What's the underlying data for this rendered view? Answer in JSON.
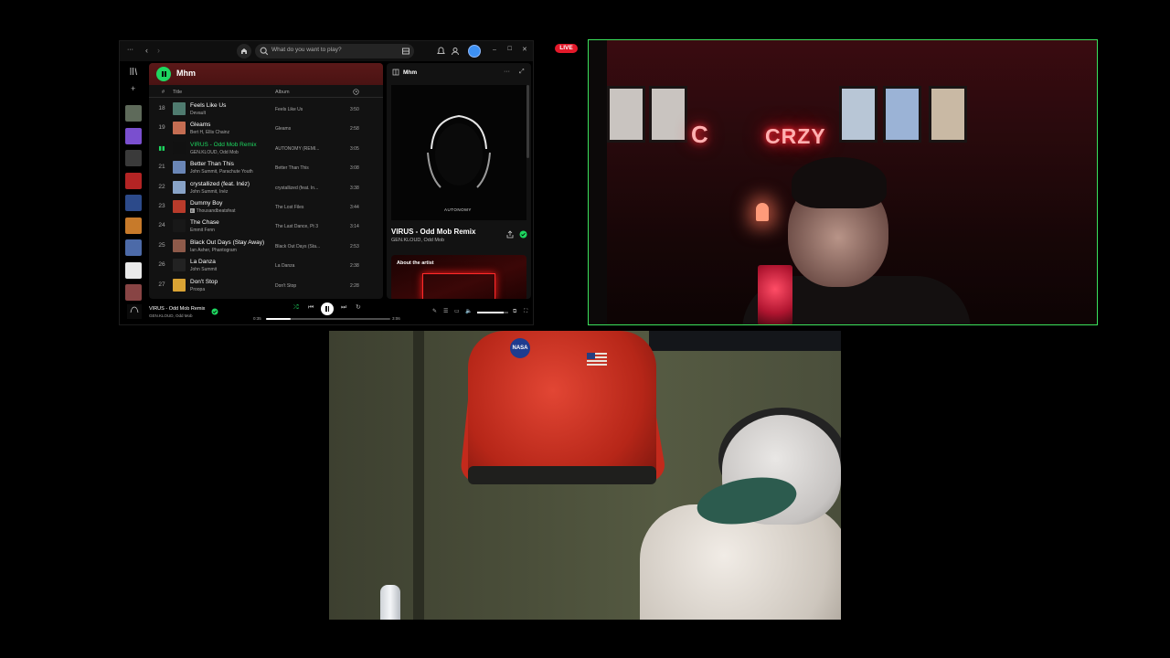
{
  "spotify": {
    "search_placeholder": "What do you want to play?",
    "playlist": {
      "title": "Mhm",
      "col_num": "#",
      "col_title": "Title",
      "col_album": "Album",
      "tracks": [
        {
          "num": "18",
          "title": "Feels Like Us",
          "artist": "Devault",
          "album": "Feels Like Us",
          "duration": "3:50",
          "color": "#4f7b6f"
        },
        {
          "num": "19",
          "title": "Gleams",
          "artist": "Bert H, Ellis Chainz",
          "album": "Gleams",
          "duration": "2:58",
          "color": "#c46d52"
        },
        {
          "num": "20",
          "title": "VIRUS - Odd Mob Remix",
          "artist": "GEN.KLOUD, Odd Mob",
          "album": "AUTONOMY (REMI...",
          "duration": "3:05",
          "color": "#111111",
          "active": true
        },
        {
          "num": "21",
          "title": "Better Than This",
          "artist": "John Summit, Parachute Youth",
          "album": "Better Than This",
          "duration": "3:08",
          "color": "#6a86b6"
        },
        {
          "num": "22",
          "title": "crystallized (feat. Inéz)",
          "artist": "John Summit, Inéz",
          "album": "crystallized (feat. In...",
          "duration": "3:38",
          "color": "#88a3c7"
        },
        {
          "num": "23",
          "title": "Dummy Boy",
          "artist": "Thousandbeatsfeat",
          "album": "The Lost Files",
          "duration": "3:44",
          "color": "#b83b2b",
          "explicit": "E"
        },
        {
          "num": "24",
          "title": "The Chase",
          "artist": "Emmit Fenn",
          "album": "The Last Dance, Pt 3",
          "duration": "3:14",
          "color": "#181818"
        },
        {
          "num": "25",
          "title": "Black Out Days (Stay Away)",
          "artist": "Ian Asher, Phantogram",
          "album": "Black Out Days (Sta...",
          "duration": "2:53",
          "color": "#8e5a4a"
        },
        {
          "num": "26",
          "title": "La Danza",
          "artist": "John Summit",
          "album": "La Danza",
          "duration": "2:38",
          "color": "#222222"
        },
        {
          "num": "27",
          "title": "Don't Stop",
          "artist": "Proopa",
          "album": "Don't Stop",
          "duration": "2:28",
          "color": "#d9a334"
        }
      ]
    },
    "now_playing": {
      "panel_title": "Mhm",
      "cover_text": "AUTONOMY",
      "title": "VIRUS - Odd Mob Remix",
      "artist": "GEN.KLOUD, Odd Mob",
      "about_label": "About the artist"
    },
    "player": {
      "title": "VIRUS - Odd Mob Remix",
      "artist": "GEN.KLOUD, Odd Mob",
      "elapsed": "0:35",
      "total": "3:06",
      "progress": 0.2,
      "volume": 0.85
    },
    "sidebar_colors": [
      "#5e6a5a",
      "#7a4fcf",
      "#3a3a3a",
      "#b32424",
      "#2c4a8a",
      "#c77a2a",
      "#4c6aa8",
      "#e9e9e9",
      "#884444"
    ]
  },
  "live_badge": "LIVE",
  "cam1": {
    "neon_text": "CRZY",
    "neon_text_left": "C"
  },
  "cam2": {
    "patch_text": "NASA"
  }
}
